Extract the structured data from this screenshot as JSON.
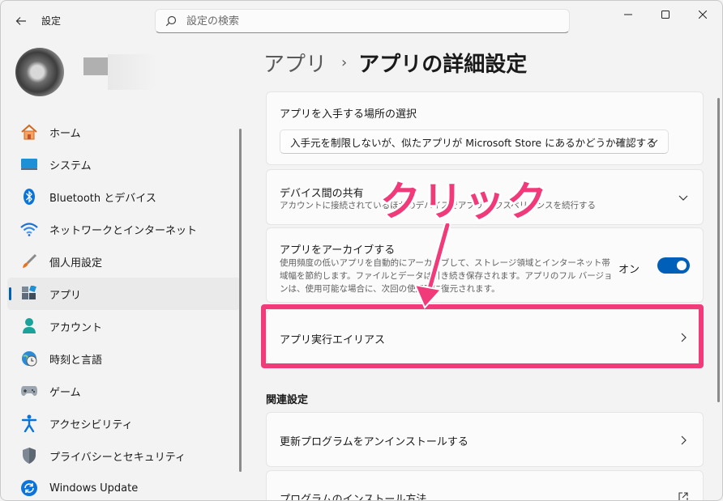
{
  "window": {
    "title": "設定",
    "search_placeholder": "設定の検索"
  },
  "sidebar": {
    "items": [
      {
        "label": "ホーム",
        "icon": "home-icon"
      },
      {
        "label": "システム",
        "icon": "system-icon"
      },
      {
        "label": "Bluetooth とデバイス",
        "icon": "bluetooth-icon"
      },
      {
        "label": "ネットワークとインターネット",
        "icon": "wifi-icon"
      },
      {
        "label": "個人用設定",
        "icon": "brush-icon"
      },
      {
        "label": "アプリ",
        "icon": "apps-icon",
        "active": true
      },
      {
        "label": "アカウント",
        "icon": "account-icon"
      },
      {
        "label": "時刻と言語",
        "icon": "globe-clock-icon"
      },
      {
        "label": "ゲーム",
        "icon": "gamepad-icon"
      },
      {
        "label": "アクセシビリティ",
        "icon": "accessibility-icon"
      },
      {
        "label": "プライバシーとセキュリティ",
        "icon": "shield-icon"
      },
      {
        "label": "Windows Update",
        "icon": "update-icon"
      }
    ]
  },
  "breadcrumb": {
    "parent": "アプリ",
    "separator": "›",
    "current": "アプリの詳細設定"
  },
  "cards": {
    "source": {
      "title": "アプリを入手する場所の選択",
      "dropdown_value": "入手元を制限しないが、似たアプリが Microsoft Store にあるかどうか確認する"
    },
    "share": {
      "title": "デバイス間の共有",
      "desc": "アカウントに接続されているほかのデバイスでアプリ エクスペリエンスを続行する"
    },
    "archive": {
      "title": "アプリをアーカイブする",
      "desc": "使用頻度の低いアプリを自動的にアーカイブして、ストレージ領域とインターネット帯域幅を節約します。ファイルとデータは引き続き保存されます。アプリのフル バージョンは、使用可能な場合に、次回の使用時に復元されます。",
      "toggle_label": "オン",
      "toggle_on": true
    },
    "alias": {
      "title": "アプリ実行エイリアス"
    }
  },
  "related": {
    "section_title": "関連設定",
    "items": [
      {
        "title": "更新プログラムをアンインストールする"
      },
      {
        "title": "プログラムのインストール方法"
      }
    ]
  },
  "annotation": {
    "text": "クリック",
    "color": "#f03a7a"
  },
  "colors": {
    "accent": "#005fb8",
    "annotation": "#f03a7a"
  }
}
